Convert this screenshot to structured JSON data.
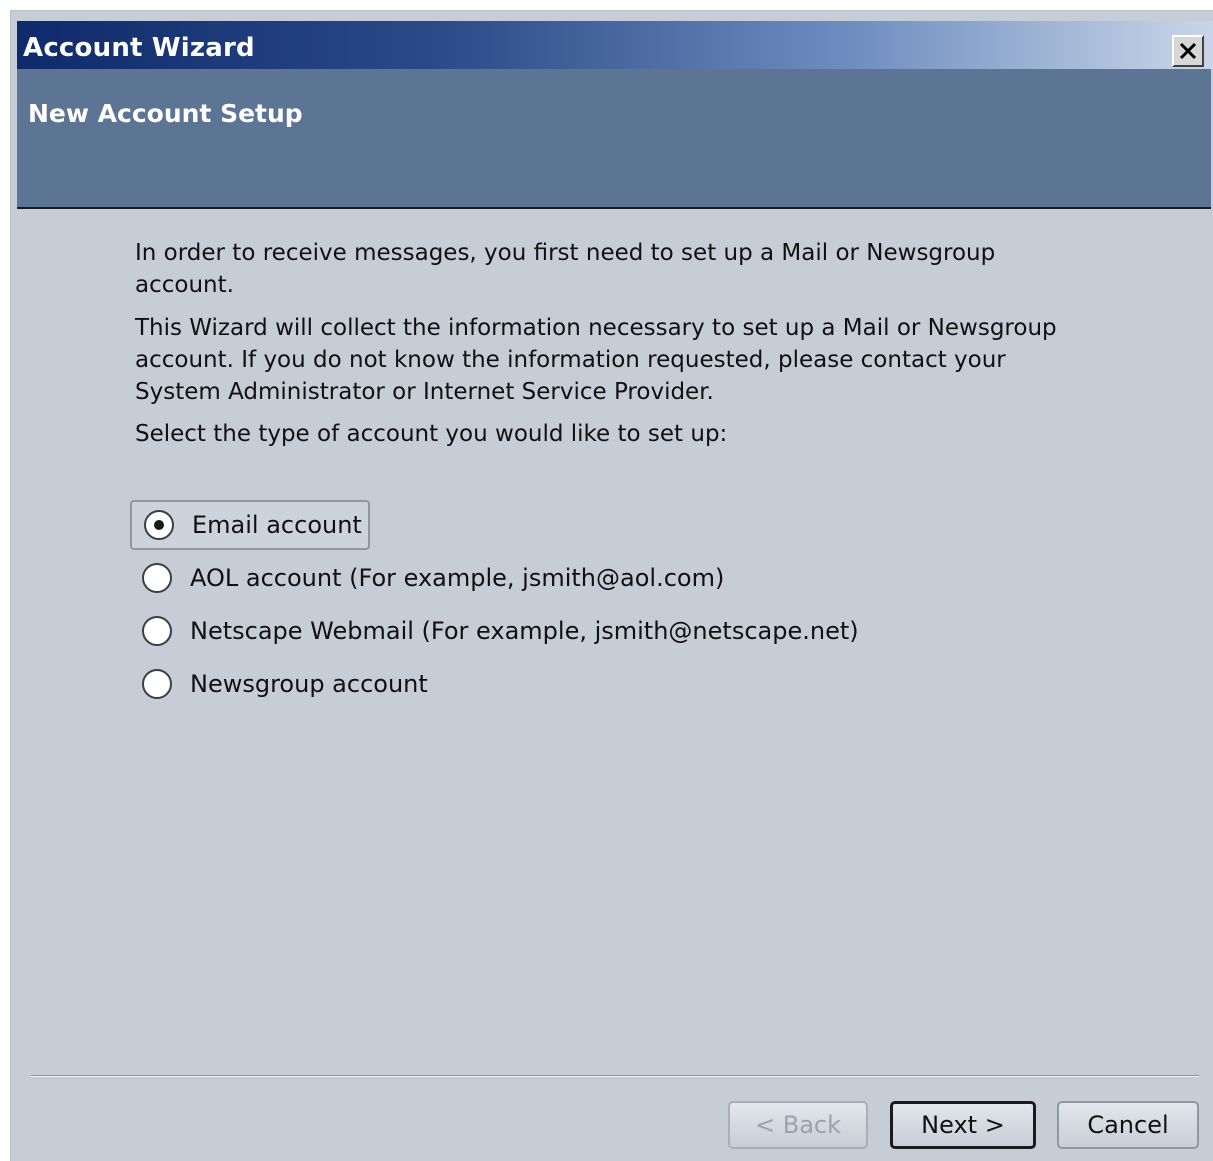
{
  "window": {
    "title": "Account Wizard"
  },
  "header": {
    "title": "New Account Setup"
  },
  "intro": {
    "paragraph1": "In order to receive messages, you first need to set up a Mail or Newsgroup account.",
    "paragraph2": "This Wizard will collect the information necessary to set up a Mail or Newsgroup account. If you do not know the information requested, please contact your System Administrator or Internet Service Provider.",
    "prompt": "Select the type of account you would like to set up:"
  },
  "account_types": [
    {
      "label": "Email account",
      "selected": true
    },
    {
      "label": "AOL account (For example, jsmith@aol.com)",
      "selected": false
    },
    {
      "label": "Netscape Webmail (For example, jsmith@netscape.net)",
      "selected": false
    },
    {
      "label": "Newsgroup account",
      "selected": false
    }
  ],
  "buttons": {
    "back": "< Back",
    "next": "Next >",
    "cancel": "Cancel"
  }
}
